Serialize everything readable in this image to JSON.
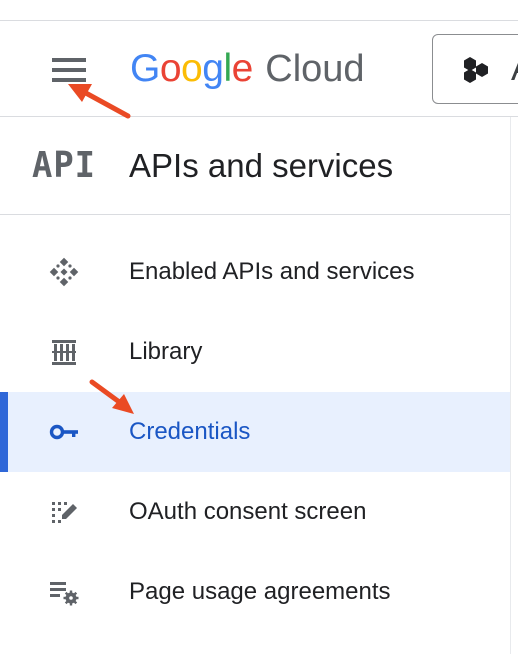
{
  "header": {
    "logo_google_letters": [
      "G",
      "o",
      "o",
      "g",
      "l",
      "e"
    ],
    "logo_google_colors": [
      "#4285F4",
      "#EA4335",
      "#FBBC05",
      "#4285F4",
      "#34A853",
      "#EA4335"
    ],
    "logo_cloud": "Cloud",
    "project_picker_text": "A",
    "icons": {
      "menu": "hamburger-menu-icon",
      "project": "hexagon-cluster-icon"
    }
  },
  "section": {
    "badge": "API",
    "title": "APIs and services"
  },
  "nav": {
    "items": [
      {
        "label": "Enabled APIs and services",
        "icon": "diamond-dots-icon",
        "active": false
      },
      {
        "label": "Library",
        "icon": "library-columns-icon",
        "active": false
      },
      {
        "label": "Credentials",
        "icon": "key-icon",
        "active": true
      },
      {
        "label": "OAuth consent screen",
        "icon": "dotted-edit-icon",
        "active": false
      },
      {
        "label": "Page usage agreements",
        "icon": "list-settings-icon",
        "active": false
      }
    ]
  },
  "annotations": {
    "arrow_color": "#EA4A24",
    "targets": [
      "hamburger-menu",
      "Credentials"
    ]
  },
  "colors": {
    "accent": "#2F67D8",
    "active_background": "#E8F0FE",
    "active_text": "#1A56C4",
    "icon_gray": "#5F6368",
    "divider": "#DADCE0"
  }
}
